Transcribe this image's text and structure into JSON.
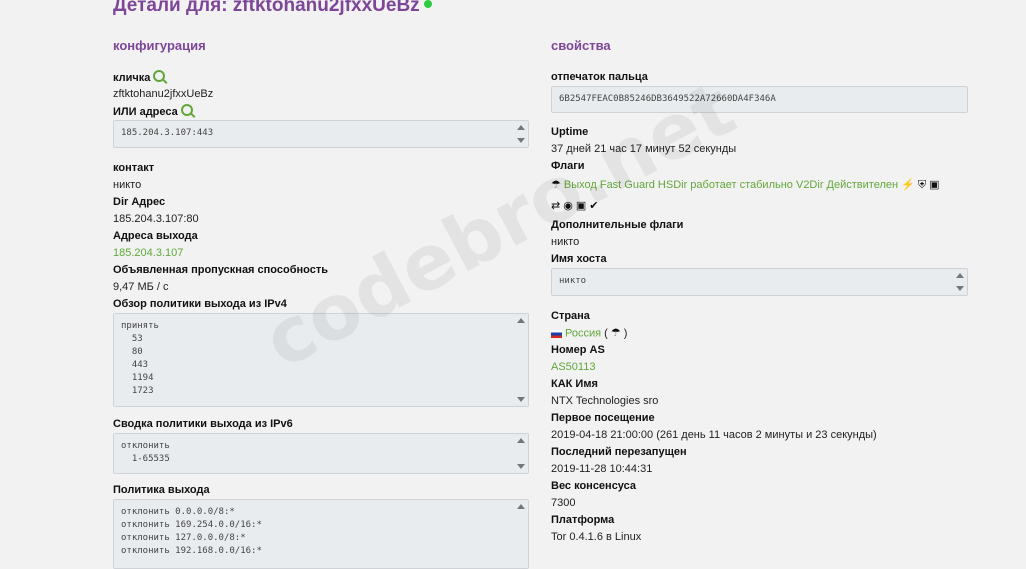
{
  "header": {
    "title": "Детали для: zftktohanu2jfxxUeBz"
  },
  "config": {
    "section_title": "конфигурация",
    "nickname_label": "кличка",
    "nickname": "zftktohanu2jfxxUeBz",
    "or_address_label": "ИЛИ адреса",
    "or_address": "185.204.3.107:443",
    "contact_label": "контакт",
    "contact": "никто",
    "dir_address_label": "Dir Адрес",
    "dir_address": "185.204.3.107:80",
    "exit_address_label": "Адреса выхода",
    "exit_address": "185.204.3.107",
    "bandwidth_label": "Объявленная пропускная способность",
    "bandwidth": "9,47 МБ / с",
    "ipv4_policy_label": "Обзор политики выхода из IPv4",
    "ipv4_policy": "принять\n  53\n  80\n  443\n  1194\n  1723",
    "ipv6_policy_label": "Сводка политики выхода из IPv6",
    "ipv6_policy": "отклонить\n  1-65535",
    "exit_policy_label": "Политика выхода",
    "exit_policy": "отклонить 0.0.0.0/8:*\nотклонить 169.254.0.0/16:*\nотклонить 127.0.0.0/8:*\nотклонить 192.168.0.0/16:*"
  },
  "props": {
    "section_title": "свойства",
    "fingerprint_label": "отпечаток пальца",
    "fingerprint": "6B2547FEAC0B85246DB3649522A72660DA4F346A",
    "uptime_label": "Uptime",
    "uptime": "37 дней 21 час 17 минут 52 секунды",
    "flags_label": "Флаги",
    "flags_text": "Выход  Fast Guard HSDir работает стабильно V2Dir Действителен",
    "extra_flags_label": "Дополнительные флаги",
    "extra_flags": "никто",
    "hostname_label": "Имя хоста",
    "hostname": "никто",
    "country_label": "Страна",
    "country": "Россия",
    "country_paren_open": " ( ",
    "country_paren_close": " )",
    "as_number_label": "Номер AS",
    "as_number": "AS50113",
    "as_name_label": "КАК Имя",
    "as_name": "NTX Technologies sro",
    "first_seen_label": "Первое посещение",
    "first_seen": "2019-04-18 21:00:00 (261 день 11 часов 2 минуты и 23 секунды)",
    "last_restart_label": "Последний перезапущен",
    "last_restart": "2019-11-28 10:44:31",
    "consensus_weight_label": "Вес консенсуса",
    "consensus_weight": "7300",
    "platform_label": "Платформа",
    "platform": "Tor 0.4.1.6 в Linux"
  },
  "icons": {
    "flag_icons": [
      "exit-icon",
      "lightning-icon",
      "shield-icon",
      "sd-card-icon",
      "swap-icon",
      "record-icon",
      "storage-icon",
      "check-circle-icon"
    ]
  },
  "colors": {
    "accent_purple": "#7d4698",
    "link_green": "#62a73b",
    "status_green": "#2ecc40"
  },
  "watermark": "codebro.net"
}
